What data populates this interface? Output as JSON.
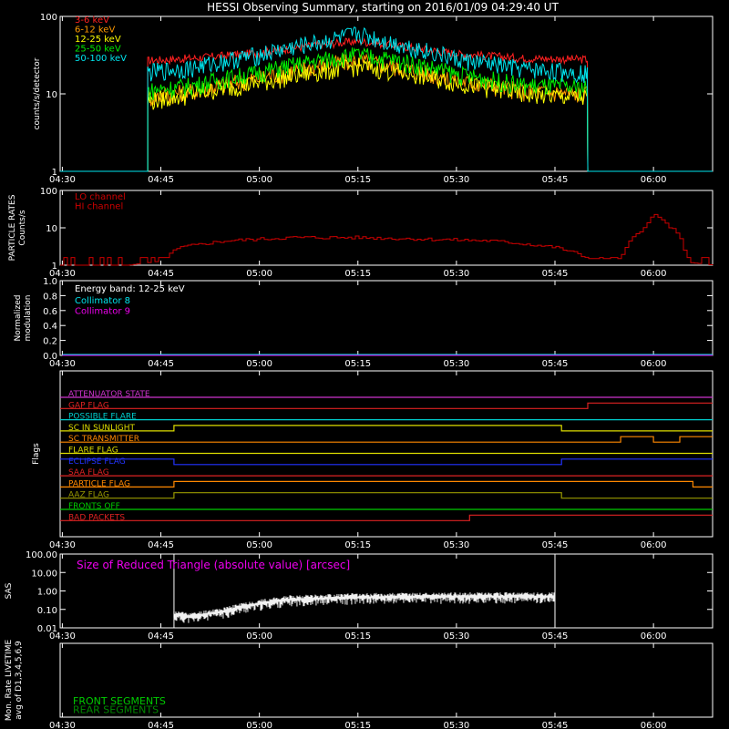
{
  "title": "HESSI Observing Summary, starting on 2016/01/09 04:29:40 UT",
  "time_labels": [
    "04:30",
    "04:45",
    "05:00",
    "05:15",
    "05:30",
    "05:45",
    "06:00"
  ],
  "chart_data": [
    {
      "type": "line",
      "panel": "count-rates",
      "ylabel": "counts/s/detector",
      "yscale": "log",
      "ylim": [
        1,
        100
      ],
      "ytick_labels": [
        "100",
        "10",
        "1"
      ],
      "active_window": [
        "04:43:00",
        "05:50:00"
      ],
      "series": [
        {
          "name": "3-6 keV",
          "color": "#ff2020",
          "x": [
            "04:43",
            "04:50",
            "05:00",
            "05:10",
            "05:15",
            "05:20",
            "05:30",
            "05:40",
            "05:49"
          ],
          "values": [
            27,
            29,
            34,
            44,
            48,
            43,
            33,
            29,
            28
          ]
        },
        {
          "name": "6-12 keV",
          "color": "#ff9900",
          "x": [
            "04:43",
            "04:50",
            "05:00",
            "05:10",
            "05:15",
            "05:20",
            "05:30",
            "05:40",
            "05:49"
          ],
          "values": [
            9,
            11,
            16,
            24,
            27,
            23,
            15,
            11,
            10
          ]
        },
        {
          "name": "12-25 keV",
          "color": "#ffff00",
          "x": [
            "04:43",
            "04:50",
            "05:00",
            "05:10",
            "05:15",
            "05:20",
            "05:30",
            "05:40",
            "05:49"
          ],
          "values": [
            8,
            10,
            14,
            20,
            23,
            20,
            14,
            10,
            9
          ]
        },
        {
          "name": "25-50 keV",
          "color": "#00ee00",
          "x": [
            "04:43",
            "04:50",
            "05:00",
            "05:10",
            "05:15",
            "05:20",
            "05:30",
            "05:40",
            "05:49"
          ],
          "values": [
            11,
            13,
            19,
            28,
            32,
            28,
            18,
            13,
            12
          ]
        },
        {
          "name": "50-100 keV",
          "color": "#00e5ee",
          "x": [
            "04:43",
            "04:50",
            "05:00",
            "05:10",
            "05:15",
            "05:20",
            "05:30",
            "05:40",
            "05:49"
          ],
          "values": [
            19,
            22,
            32,
            48,
            60,
            46,
            28,
            21,
            19
          ]
        }
      ]
    },
    {
      "type": "line",
      "panel": "particle-rates",
      "ylabel_lines": [
        "PARTICLE RATES",
        "Counts/s"
      ],
      "yscale": "log",
      "ylim": [
        1,
        100
      ],
      "ytick_labels": [
        "100",
        "10",
        "1"
      ],
      "series": [
        {
          "name": "LO channel",
          "color": "#cc0000",
          "x": [
            "04:30",
            "04:40",
            "04:45",
            "04:48",
            "04:55",
            "05:05",
            "05:15",
            "05:25",
            "05:35",
            "05:45",
            "05:50",
            "05:55",
            "05:58",
            "06:00",
            "06:02",
            "06:05",
            "06:09"
          ],
          "values": [
            1,
            1,
            1.3,
            3,
            4.5,
            5.5,
            5.5,
            5,
            4.5,
            3,
            1.5,
            1.5,
            8,
            22,
            12,
            1.2,
            1
          ]
        },
        {
          "name": "HI channel",
          "color": "#cc0000",
          "x": [],
          "values": []
        }
      ]
    },
    {
      "type": "line",
      "panel": "modulation",
      "ylabel_lines": [
        "Normalized",
        "modulation"
      ],
      "ylim": [
        0,
        1
      ],
      "ytick_labels": [
        "1.0",
        "0.8",
        "0.6",
        "0.4",
        "0.2",
        "0.0"
      ],
      "note": "Energy band: 12-25 keV",
      "series": [
        {
          "name": "Collimator 8",
          "color": "#00e5ee",
          "x": [
            "04:30",
            "06:09"
          ],
          "values": [
            0,
            0
          ]
        },
        {
          "name": "Collimator 9",
          "color": "#ee00ee",
          "x": [
            "04:30",
            "06:09"
          ],
          "values": [
            0,
            0
          ]
        }
      ]
    },
    {
      "type": "line",
      "panel": "flags",
      "ylabel": "Flags",
      "series": [
        {
          "name": "ATTENUATOR STATE",
          "color": "#cc33cc",
          "x": [
            "04:30"
          ],
          "values": [
            0
          ]
        },
        {
          "name": "GAP FLAG",
          "color": "#dd2222",
          "x": [
            "04:30",
            "05:50"
          ],
          "values": [
            0,
            1
          ]
        },
        {
          "name": "POSSIBLE FLARE",
          "color": "#00cccc",
          "x": [
            "04:30"
          ],
          "values": [
            0
          ]
        },
        {
          "name": "SC IN SUNLIGHT",
          "color": "#dddd00",
          "x": [
            "04:30",
            "04:47",
            "05:46"
          ],
          "values": [
            0,
            1,
            0
          ]
        },
        {
          "name": "SC TRANSMITTER",
          "color": "#ff8800",
          "x": [
            "04:30",
            "05:50",
            "05:55",
            "06:00",
            "06:04"
          ],
          "values": [
            0,
            0,
            1,
            0,
            1
          ]
        },
        {
          "name": "FLARE FLAG",
          "color": "#dddd00",
          "x": [
            "04:30"
          ],
          "values": [
            0
          ]
        },
        {
          "name": "ECLIPSE FLAG",
          "color": "#2233ff",
          "x": [
            "04:30",
            "04:47",
            "05:46"
          ],
          "values": [
            1,
            0,
            1
          ]
        },
        {
          "name": "SAA FLAG",
          "color": "#dd2222",
          "x": [
            "04:30"
          ],
          "values": [
            0
          ]
        },
        {
          "name": "PARTICLE FLAG",
          "color": "#ff8800",
          "x": [
            "04:30",
            "04:47",
            "05:48",
            "05:53",
            "06:00",
            "06:06"
          ],
          "values": [
            0,
            1,
            1,
            1,
            1,
            0
          ]
        },
        {
          "name": "AAZ FLAG",
          "color": "#999900",
          "x": [
            "04:30",
            "04:47",
            "05:46"
          ],
          "values": [
            0,
            1,
            0
          ]
        },
        {
          "name": "FRONTS OFF",
          "color": "#00cc00",
          "x": [
            "04:30"
          ],
          "values": [
            0
          ]
        },
        {
          "name": "BAD PACKETS",
          "color": "#dd2222",
          "x": [
            "04:30",
            "05:32"
          ],
          "values": [
            0,
            1
          ]
        }
      ]
    },
    {
      "type": "line",
      "panel": "sas",
      "ylabel": "SAS",
      "yscale": "log",
      "ylim": [
        0.01,
        100
      ],
      "ytick_labels": [
        "100.00",
        "10.00",
        "1.00",
        "0.10",
        "0.01"
      ],
      "annotation": "Size of Reduced Triangle (absolute value) [arcsec]",
      "series": [
        {
          "name": "",
          "color": "#ffffff",
          "x": [
            "04:47",
            "04:50",
            "04:55",
            "05:00",
            "05:05",
            "05:15",
            "05:30",
            "05:45"
          ],
          "values": [
            0.05,
            0.04,
            0.08,
            0.2,
            0.35,
            0.45,
            0.5,
            0.5
          ]
        }
      ]
    },
    {
      "type": "line",
      "panel": "livetime",
      "ylabel_lines": [
        "Mon. Rate LIVETIME",
        "avg of D1,3,4,5,6,9"
      ],
      "series": [
        {
          "name": "FRONT SEGMENTS",
          "color": "#00cc00",
          "x": [],
          "values": []
        },
        {
          "name": "REAR SEGMENTS",
          "color": "#008800",
          "x": [],
          "values": []
        }
      ]
    }
  ]
}
